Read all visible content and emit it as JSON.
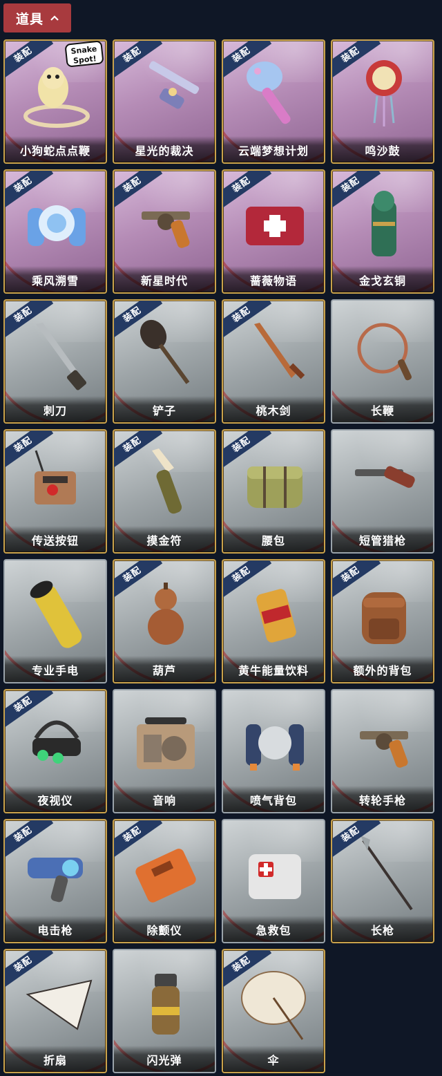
{
  "section": {
    "label": "道具"
  },
  "badge_text": "装配",
  "items": [
    {
      "name": "小狗蛇点点鞭",
      "equipped": true,
      "theme": "purple",
      "icon": "snake-whip-icon",
      "logo": "Snake Spot!"
    },
    {
      "name": "星光的裁决",
      "equipped": true,
      "theme": "purple",
      "icon": "ornate-shotgun-icon"
    },
    {
      "name": "云端梦想计划",
      "equipped": true,
      "theme": "purple",
      "icon": "magic-wand-icon"
    },
    {
      "name": "鸣沙鼓",
      "equipped": true,
      "theme": "purple",
      "icon": "ornament-drum-icon"
    },
    {
      "name": "乘风溯雪",
      "equipped": true,
      "theme": "purple",
      "icon": "snow-jetpack-icon"
    },
    {
      "name": "新星时代",
      "equipped": true,
      "theme": "purple",
      "icon": "revolver-icon"
    },
    {
      "name": "蔷薇物语",
      "equipped": true,
      "theme": "purple",
      "icon": "medkit-red-icon"
    },
    {
      "name": "金戈玄铜",
      "equipped": true,
      "theme": "purple",
      "icon": "bronze-grenade-icon"
    },
    {
      "name": "刺刀",
      "equipped": true,
      "theme": "gray",
      "icon": "bayonet-icon"
    },
    {
      "name": "铲子",
      "equipped": true,
      "theme": "gray",
      "icon": "shovel-icon"
    },
    {
      "name": "桃木剑",
      "equipped": true,
      "theme": "gray",
      "icon": "wooden-sword-icon"
    },
    {
      "name": "长鞭",
      "equipped": false,
      "theme": "gray",
      "icon": "whip-icon"
    },
    {
      "name": "传送按钮",
      "equipped": true,
      "theme": "gray",
      "icon": "teleport-button-icon"
    },
    {
      "name": "摸金符",
      "equipped": true,
      "theme": "gray",
      "icon": "talisman-icon"
    },
    {
      "name": "腰包",
      "equipped": true,
      "theme": "gray",
      "icon": "waist-bag-icon"
    },
    {
      "name": "短管猎枪",
      "equipped": false,
      "theme": "gray",
      "icon": "sawed-off-shotgun-icon"
    },
    {
      "name": "专业手电",
      "equipped": false,
      "theme": "gray",
      "icon": "flashlight-icon"
    },
    {
      "name": "葫芦",
      "equipped": true,
      "theme": "gray",
      "icon": "gourd-icon"
    },
    {
      "name": "黄牛能量饮料",
      "equipped": true,
      "theme": "gray",
      "icon": "energy-drink-icon"
    },
    {
      "name": "额外的背包",
      "equipped": true,
      "theme": "gray",
      "icon": "backpack-icon"
    },
    {
      "name": "夜视仪",
      "equipped": true,
      "theme": "gray",
      "icon": "night-vision-icon"
    },
    {
      "name": "音响",
      "equipped": false,
      "theme": "gray",
      "icon": "radio-speaker-icon"
    },
    {
      "name": "喷气背包",
      "equipped": false,
      "theme": "gray",
      "icon": "jetpack-icon"
    },
    {
      "name": "转轮手枪",
      "equipped": false,
      "theme": "gray",
      "icon": "revolver-icon"
    },
    {
      "name": "电击枪",
      "equipped": true,
      "theme": "gray",
      "icon": "taser-gun-icon"
    },
    {
      "name": "除颤仪",
      "equipped": true,
      "theme": "gray",
      "icon": "defibrillator-icon"
    },
    {
      "name": "急救包",
      "equipped": false,
      "theme": "gray",
      "icon": "first-aid-kit-icon"
    },
    {
      "name": "长枪",
      "equipped": true,
      "theme": "gray",
      "icon": "spear-icon"
    },
    {
      "name": "折扇",
      "equipped": true,
      "theme": "gray",
      "icon": "folding-fan-icon"
    },
    {
      "name": "闪光弹",
      "equipped": false,
      "theme": "gray",
      "icon": "flashbang-icon"
    },
    {
      "name": "伞",
      "equipped": true,
      "theme": "gray",
      "icon": "umbrella-icon"
    }
  ]
}
